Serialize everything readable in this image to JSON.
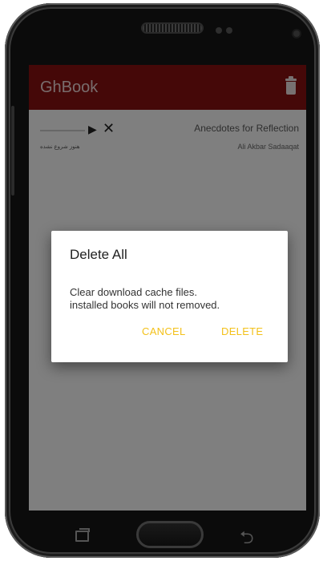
{
  "app": {
    "title": "GhBook",
    "trash_icon": "trash-icon",
    "accent_color": "#8b1010"
  },
  "book_item": {
    "title": "Anecdotes for Reflection",
    "author": "Ali Akbar Sadaaqat",
    "status": "هنوز شروع نشده",
    "play_icon": "play-icon",
    "close_icon": "close-icon"
  },
  "dialog": {
    "title": "Delete All",
    "message": "Clear download cache files.\ninstalled books will not removed.",
    "cancel_label": "CANCEL",
    "delete_label": "DELETE",
    "button_color": "#f3c11a"
  },
  "nav": {
    "recent_icon": "recent-apps-icon",
    "home_icon": "home-button",
    "back_icon": "back-icon"
  }
}
